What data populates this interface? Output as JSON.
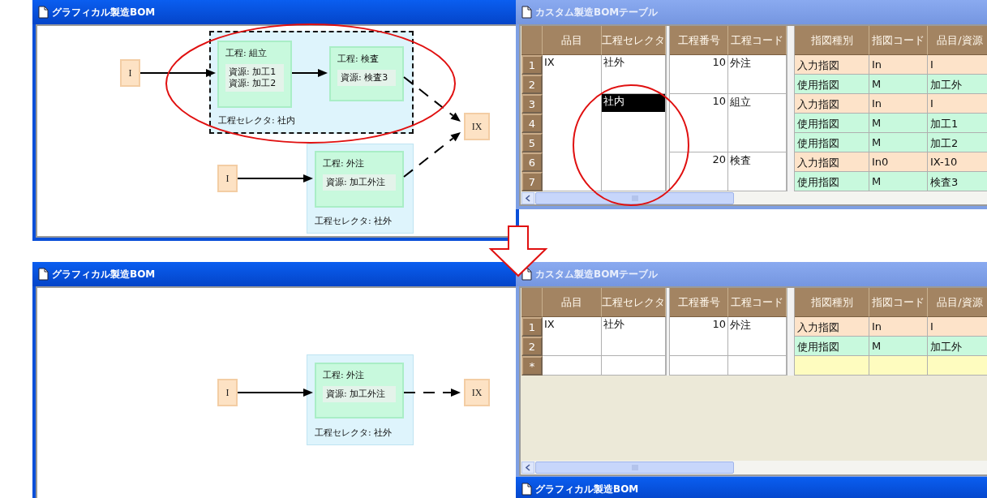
{
  "panels": [
    {
      "graph_window": {
        "title": "グラフィカル製造BOM",
        "active": true,
        "inputs": [
          {
            "label": "I"
          },
          {
            "label": "I"
          }
        ],
        "groups": [
          {
            "selector_label": "工程セレクタ: 社内",
            "selected": true,
            "processes": [
              {
                "title": "工程: 組立",
                "resources": [
                  "資源: 加工1",
                  "資源: 加工2"
                ]
              },
              {
                "title": "工程: 検査",
                "resources": [
                  "資源: 検査3"
                ]
              }
            ]
          },
          {
            "selector_label": "工程セレクタ: 社外",
            "selected": false,
            "processes": [
              {
                "title": "工程: 外注",
                "resources": [
                  "資源: 加工外注"
                ]
              }
            ]
          }
        ],
        "outputs": [
          {
            "label": "IX"
          }
        ],
        "edges": [
          {
            "kind": "solid"
          },
          {
            "kind": "solid"
          },
          {
            "kind": "dashed"
          },
          {
            "kind": "solid"
          },
          {
            "kind": "dashed"
          }
        ]
      },
      "table_window": {
        "title": "カスタム製造BOMテーブル",
        "active": false,
        "columns": [
          "品目",
          "工程セレクタ",
          "工程番号",
          "工程コード",
          "指図種別",
          "指図コード",
          "品目/資源"
        ],
        "items": [
          {
            "name": "IX",
            "selectors": [
              {
                "label": "社外",
                "selected": false,
                "operations": [
                  {
                    "number": "10",
                    "code": "外注",
                    "orders": [
                      {
                        "row": "1",
                        "kind": "input",
                        "type": "入力指図",
                        "code": "In",
                        "target": "I"
                      },
                      {
                        "row": "2",
                        "kind": "use",
                        "type": "使用指図",
                        "code": "M",
                        "target": "加工外"
                      }
                    ]
                  }
                ]
              },
              {
                "label": "社内",
                "selected": true,
                "operations": [
                  {
                    "number": "10",
                    "code": "組立",
                    "orders": [
                      {
                        "row": "3",
                        "kind": "input",
                        "type": "入力指図",
                        "code": "In",
                        "target": "I"
                      },
                      {
                        "row": "4",
                        "kind": "use",
                        "type": "使用指図",
                        "code": "M",
                        "target": "加工1"
                      },
                      {
                        "row": "5",
                        "kind": "use",
                        "type": "使用指図",
                        "code": "M",
                        "target": "加工2"
                      }
                    ]
                  },
                  {
                    "number": "20",
                    "code": "検査",
                    "orders": [
                      {
                        "row": "6",
                        "kind": "input",
                        "type": "入力指図",
                        "code": "In0",
                        "target": "IX-10"
                      },
                      {
                        "row": "7",
                        "kind": "use",
                        "type": "使用指図",
                        "code": "M",
                        "target": "検査3"
                      }
                    ]
                  }
                ]
              }
            ]
          }
        ]
      }
    },
    {
      "graph_window": {
        "title": "グラフィカル製造BOM",
        "active": true,
        "inputs": [
          {
            "label": "I"
          }
        ],
        "groups": [
          {
            "selector_label": "工程セレクタ: 社外",
            "selected": false,
            "processes": [
              {
                "title": "工程: 外注",
                "resources": [
                  "資源: 加工外注"
                ]
              }
            ]
          }
        ],
        "outputs": [
          {
            "label": "IX"
          }
        ],
        "edges": [
          {
            "kind": "solid"
          },
          {
            "kind": "dashed"
          }
        ]
      },
      "table_window": {
        "title": "カスタム製造BOMテーブル",
        "active": false,
        "columns": [
          "品目",
          "工程セレクタ",
          "工程番号",
          "工程コード",
          "指図種別",
          "指図コード",
          "品目/資源"
        ],
        "items": [
          {
            "name": "IX",
            "selectors": [
              {
                "label": "社外",
                "selected": false,
                "operations": [
                  {
                    "number": "10",
                    "code": "外注",
                    "orders": [
                      {
                        "row": "1",
                        "kind": "input",
                        "type": "入力指図",
                        "code": "In",
                        "target": "I"
                      },
                      {
                        "row": "2",
                        "kind": "use",
                        "type": "使用指図",
                        "code": "M",
                        "target": "加工外"
                      }
                    ]
                  }
                ]
              }
            ]
          }
        ],
        "new_row": {
          "marker": "*"
        }
      }
    }
  ],
  "bottom_window": {
    "title": "グラフィカル製造BOM",
    "active": true
  }
}
